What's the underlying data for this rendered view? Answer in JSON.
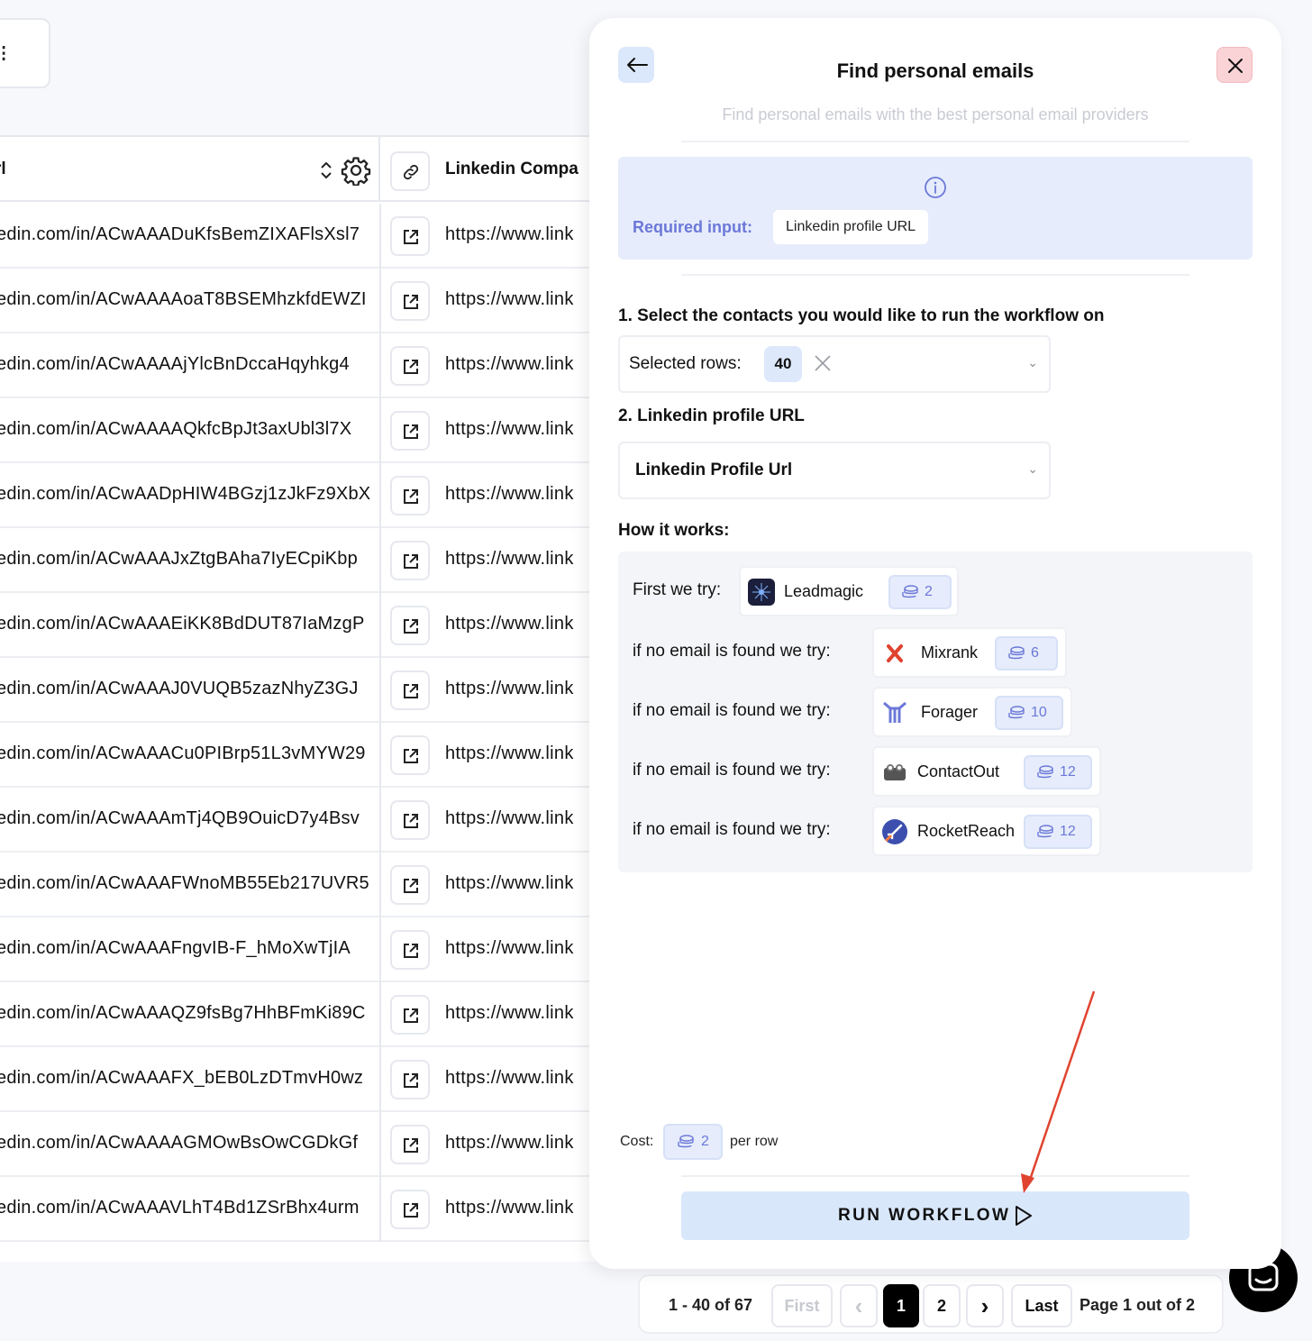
{
  "background_table": {
    "top_card_glyph": "⁝",
    "header": {
      "col1_title": "rl",
      "col2_title": "Linkedin Compa"
    },
    "rows": [
      {
        "profile_url": "edin.com/in/ACwAAADuKfsBemZIXAFlsXsl7",
        "company_url": "https://www.link"
      },
      {
        "profile_url": "edin.com/in/ACwAAAAoaT8BSEMhzkfdEWZI",
        "company_url": "https://www.link"
      },
      {
        "profile_url": "edin.com/in/ACwAAAAjYlcBnDccaHqyhkg4",
        "company_url": "https://www.link"
      },
      {
        "profile_url": "edin.com/in/ACwAAAAQkfcBpJt3axUbl3l7X",
        "company_url": "https://www.link"
      },
      {
        "profile_url": "edin.com/in/ACwAADpHIW4BGzj1zJkFz9XbX",
        "company_url": "https://www.link"
      },
      {
        "profile_url": "edin.com/in/ACwAAAJxZtgBAha7IyECpiKbp",
        "company_url": "https://www.link"
      },
      {
        "profile_url": "edin.com/in/ACwAAAEiKK8BdDUT87IaMzgP",
        "company_url": "https://www.link"
      },
      {
        "profile_url": "edin.com/in/ACwAAAJ0VUQB5zazNhyZ3GJ",
        "company_url": "https://www.link"
      },
      {
        "profile_url": "edin.com/in/ACwAAACu0PIBrp51L3vMYW29",
        "company_url": "https://www.link"
      },
      {
        "profile_url": "edin.com/in/ACwAAAmTj4QB9OuicD7y4Bsv",
        "company_url": "https://www.link"
      },
      {
        "profile_url": "edin.com/in/ACwAAAFWnoMB55Eb217UVR5",
        "company_url": "https://www.link"
      },
      {
        "profile_url": "edin.com/in/ACwAAAFngvIB-F_hMoXwTjIA",
        "company_url": "https://www.link"
      },
      {
        "profile_url": "edin.com/in/ACwAAAQZ9fsBg7HhBFmKi89C",
        "company_url": "https://www.link"
      },
      {
        "profile_url": "edin.com/in/ACwAAAFX_bEB0LzDTmvH0wz",
        "company_url": "https://www.link"
      },
      {
        "profile_url": "edin.com/in/ACwAAAAGMOwBsOwCGDkGf",
        "company_url": "https://www.link"
      },
      {
        "profile_url": "edin.com/in/ACwAAAVLhT4Bd1ZSrBhx4urm",
        "company_url": "https://www.link"
      }
    ]
  },
  "pagination": {
    "range": "1 - 40 of 67",
    "first": "First",
    "page1": "1",
    "page2": "2",
    "last": "Last",
    "page_info": "Page 1 out of 2",
    "prev_glyph": "‹",
    "next_glyph": "›"
  },
  "panel": {
    "title": "Find personal emails",
    "subtitle": "Find personal emails with the best personal email providers",
    "required_label": "Required input:",
    "required_value": "Linkedin profile URL",
    "step1_label": "1. Select the contacts you would like to run the workflow on",
    "selected_rows_label": "Selected rows:",
    "selected_rows_count": "40",
    "step2_label": "2. Linkedin profile URL",
    "step2_value": "Linkedin Profile Url",
    "how_label": "How it works:",
    "providers": [
      {
        "prefix": "First we try:",
        "name": "Leadmagic",
        "credits": "2",
        "logo": "leadmagic-logo"
      },
      {
        "prefix": "if no email is found we try:",
        "name": "Mixrank",
        "credits": "6",
        "logo": "mixrank-logo"
      },
      {
        "prefix": "if no email is found we try:",
        "name": "Forager",
        "credits": "10",
        "logo": "forager-logo"
      },
      {
        "prefix": "if no email is found we try:",
        "name": "ContactOut",
        "credits": "12",
        "logo": "contactout-logo"
      },
      {
        "prefix": "if no email is found we try:",
        "name": "RocketReach",
        "credits": "12",
        "logo": "rocketreach-logo"
      }
    ],
    "cost_label": "Cost:",
    "cost_value": "2",
    "cost_unit": "per row",
    "run_button": "RUN WORKFLOW",
    "chevron_glyph": "⌄"
  },
  "colors": {
    "accent": "#6b78d8",
    "run_button_bg": "#d9e7fb",
    "close_bg": "#f9d3d6",
    "annotation_arrow": "#e0432f"
  }
}
